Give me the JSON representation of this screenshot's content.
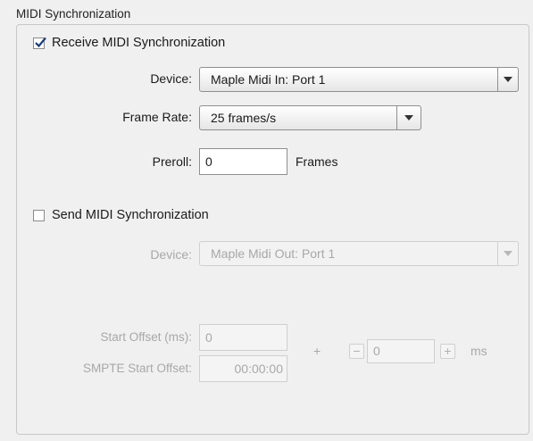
{
  "group": {
    "title": "MIDI Synchronization"
  },
  "receive": {
    "checkbox_label": "Receive MIDI Synchronization",
    "checked": true,
    "device_label": "Device:",
    "device_value": "Maple Midi In: Port 1",
    "frame_rate_label": "Frame Rate:",
    "frame_rate_value": "25 frames/s",
    "preroll_label": "Preroll:",
    "preroll_value": "0",
    "preroll_unit": "Frames"
  },
  "send": {
    "checkbox_label": "Send MIDI Synchronization",
    "checked": false,
    "device_label": "Device:",
    "device_value": "Maple Midi Out: Port 1",
    "start_offset_label": "Start Offset (ms):",
    "start_offset_value": "0",
    "smpte_label": "SMPTE Start Offset:",
    "smpte_value": "00:00:00",
    "plus_sign": "+",
    "minus_button": "−",
    "plus_button": "+",
    "ms_value": "0",
    "ms_unit": "ms"
  },
  "icons": {
    "check": "checkmark-icon",
    "dropdown": "chevron-down-icon"
  }
}
